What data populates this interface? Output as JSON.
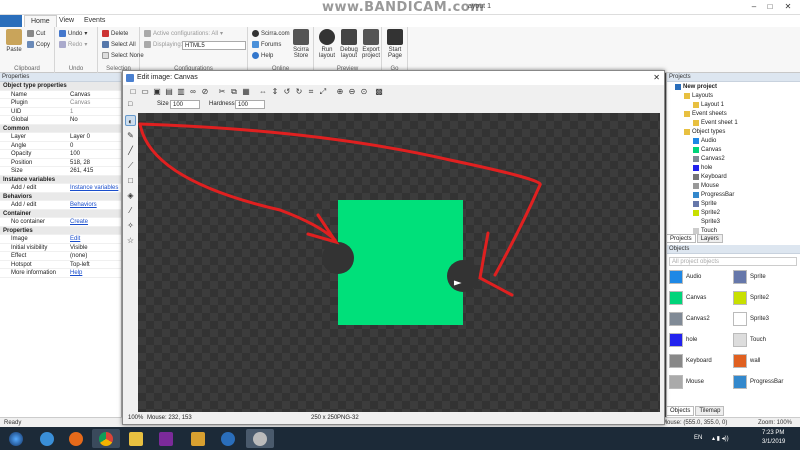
{
  "window": {
    "title": "ayout 1",
    "watermark": "www.BANDICAM.com"
  },
  "ribbon_tabs": [
    "Home",
    "View",
    "Events"
  ],
  "ribbon": {
    "clipboard": {
      "paste": "Paste",
      "cut": "Cut",
      "copy": "Copy",
      "group": "Clipboard"
    },
    "undo": {
      "undo": "Undo",
      "redo": "Redo",
      "group": "Undo"
    },
    "selection": {
      "delete": "Delete",
      "select_all": "Select All",
      "select_none": "Select None",
      "group": "Selection"
    },
    "configurations": {
      "active": "Active configurations: All",
      "displaying_label": "Displaying:",
      "displaying_value": "HTML5",
      "group": "Configurations"
    },
    "online": {
      "scirra": "Scirra.com",
      "forums": "Forums",
      "help": "Help",
      "store": "Scirra Store",
      "group": "Online"
    },
    "preview": {
      "run": "Run layout",
      "debug": "Debug layout",
      "export": "Export project",
      "group": "Preview"
    },
    "go": {
      "start": "Start Page",
      "group": "Go"
    }
  },
  "properties": {
    "title": "Properties",
    "rows": [
      {
        "k": "Object type properties",
        "v": "",
        "section": true
      },
      {
        "k": "Name",
        "v": "Canvas"
      },
      {
        "k": "Plugin",
        "v": "Canvas",
        "dim": true
      },
      {
        "k": "UID",
        "v": "1",
        "dim": true
      },
      {
        "k": "Global",
        "v": "No"
      },
      {
        "k": "Common",
        "v": "",
        "section": true
      },
      {
        "k": "Layer",
        "v": "Layer 0"
      },
      {
        "k": "Angle",
        "v": "0"
      },
      {
        "k": "Opacity",
        "v": "100"
      },
      {
        "k": "Position",
        "v": "518, 28"
      },
      {
        "k": "Size",
        "v": "261, 415"
      },
      {
        "k": "Instance variables",
        "v": "",
        "section": true
      },
      {
        "k": "Add / edit",
        "v": "Instance variables",
        "link": true
      },
      {
        "k": "Behaviors",
        "v": "",
        "section": true
      },
      {
        "k": "Add / edit",
        "v": "Behaviors",
        "link": true
      },
      {
        "k": "Container",
        "v": "",
        "section": true
      },
      {
        "k": "No container",
        "v": "Create",
        "link": true
      },
      {
        "k": "Properties",
        "v": "",
        "section": true
      },
      {
        "k": "Image",
        "v": "Edit",
        "link": true
      },
      {
        "k": "Initial visibility",
        "v": "Visible"
      },
      {
        "k": "Effect",
        "v": "(none)"
      },
      {
        "k": "Hotspot",
        "v": "Top-left"
      },
      {
        "k": "More information",
        "v": "Help",
        "link": true
      }
    ]
  },
  "projects": {
    "title": "Projects",
    "tree": [
      {
        "label": "New project",
        "indent": 0,
        "bold": true
      },
      {
        "label": "Layouts",
        "indent": 1
      },
      {
        "label": "Layout 1",
        "indent": 2
      },
      {
        "label": "Event sheets",
        "indent": 1
      },
      {
        "label": "Event sheet 1",
        "indent": 2
      },
      {
        "label": "Object types",
        "indent": 1
      },
      {
        "label": "Audio",
        "indent": 2,
        "color": "#1e88e5"
      },
      {
        "label": "Canvas",
        "indent": 2,
        "color": "#00d47a"
      },
      {
        "label": "Canvas2",
        "indent": 2,
        "color": "#808a96"
      },
      {
        "label": "hole",
        "indent": 2,
        "color": "#2222ee"
      },
      {
        "label": "Keyboard",
        "indent": 2,
        "color": "#777777"
      },
      {
        "label": "Mouse",
        "indent": 2,
        "color": "#999999"
      },
      {
        "label": "ProgressBar",
        "indent": 2,
        "color": "#3388cc"
      },
      {
        "label": "Sprite",
        "indent": 2,
        "color": "#6677aa"
      },
      {
        "label": "Sprite2",
        "indent": 2,
        "color": "#c8e000"
      },
      {
        "label": "Sprite3",
        "indent": 2,
        "color": "#ffffff"
      },
      {
        "label": "Touch",
        "indent": 2,
        "color": "#cccccc"
      }
    ],
    "tabs": [
      "Projects",
      "Layers"
    ]
  },
  "objects": {
    "title": "Objects",
    "search_placeholder": "All project objects",
    "items": [
      {
        "label": "Audio",
        "color": "#1e88e5"
      },
      {
        "label": "Sprite",
        "color": "#6677aa"
      },
      {
        "label": "Canvas",
        "color": "#00d47a"
      },
      {
        "label": "Sprite2",
        "color": "#c8e000"
      },
      {
        "label": "Canvas2",
        "color": "#808a96"
      },
      {
        "label": "Sprite3",
        "color": "#ffffff"
      },
      {
        "label": "hole",
        "color": "#2222ee"
      },
      {
        "label": "Touch",
        "color": "#dddddd"
      },
      {
        "label": "Keyboard",
        "color": "#888888"
      },
      {
        "label": "wall",
        "color": "#e06020"
      },
      {
        "label": "Mouse",
        "color": "#aaaaaa"
      },
      {
        "label": "ProgressBar",
        "color": "#3388cc"
      }
    ],
    "tabs": [
      "Objects",
      "Tilemap"
    ]
  },
  "status": {
    "ready": "Ready",
    "mouse": "Mouse: (555.0, 355.0, 0)",
    "zoom": "Zoom: 100%"
  },
  "dialog": {
    "title": "Edit image: Canvas",
    "size_label": "Size",
    "size_value": "100",
    "hardness_label": "Hardness",
    "hardness_value": "100",
    "status_zoom": "100%",
    "status_mouse": "Mouse: 232, 153",
    "status_dims": "250 x 250",
    "status_format": "PNG-32",
    "image_color": "#00e07a",
    "hole_color": "#333333"
  },
  "taskbar": {
    "lang": "EN",
    "time": "7:23 PM",
    "date": "3/1/2019"
  }
}
